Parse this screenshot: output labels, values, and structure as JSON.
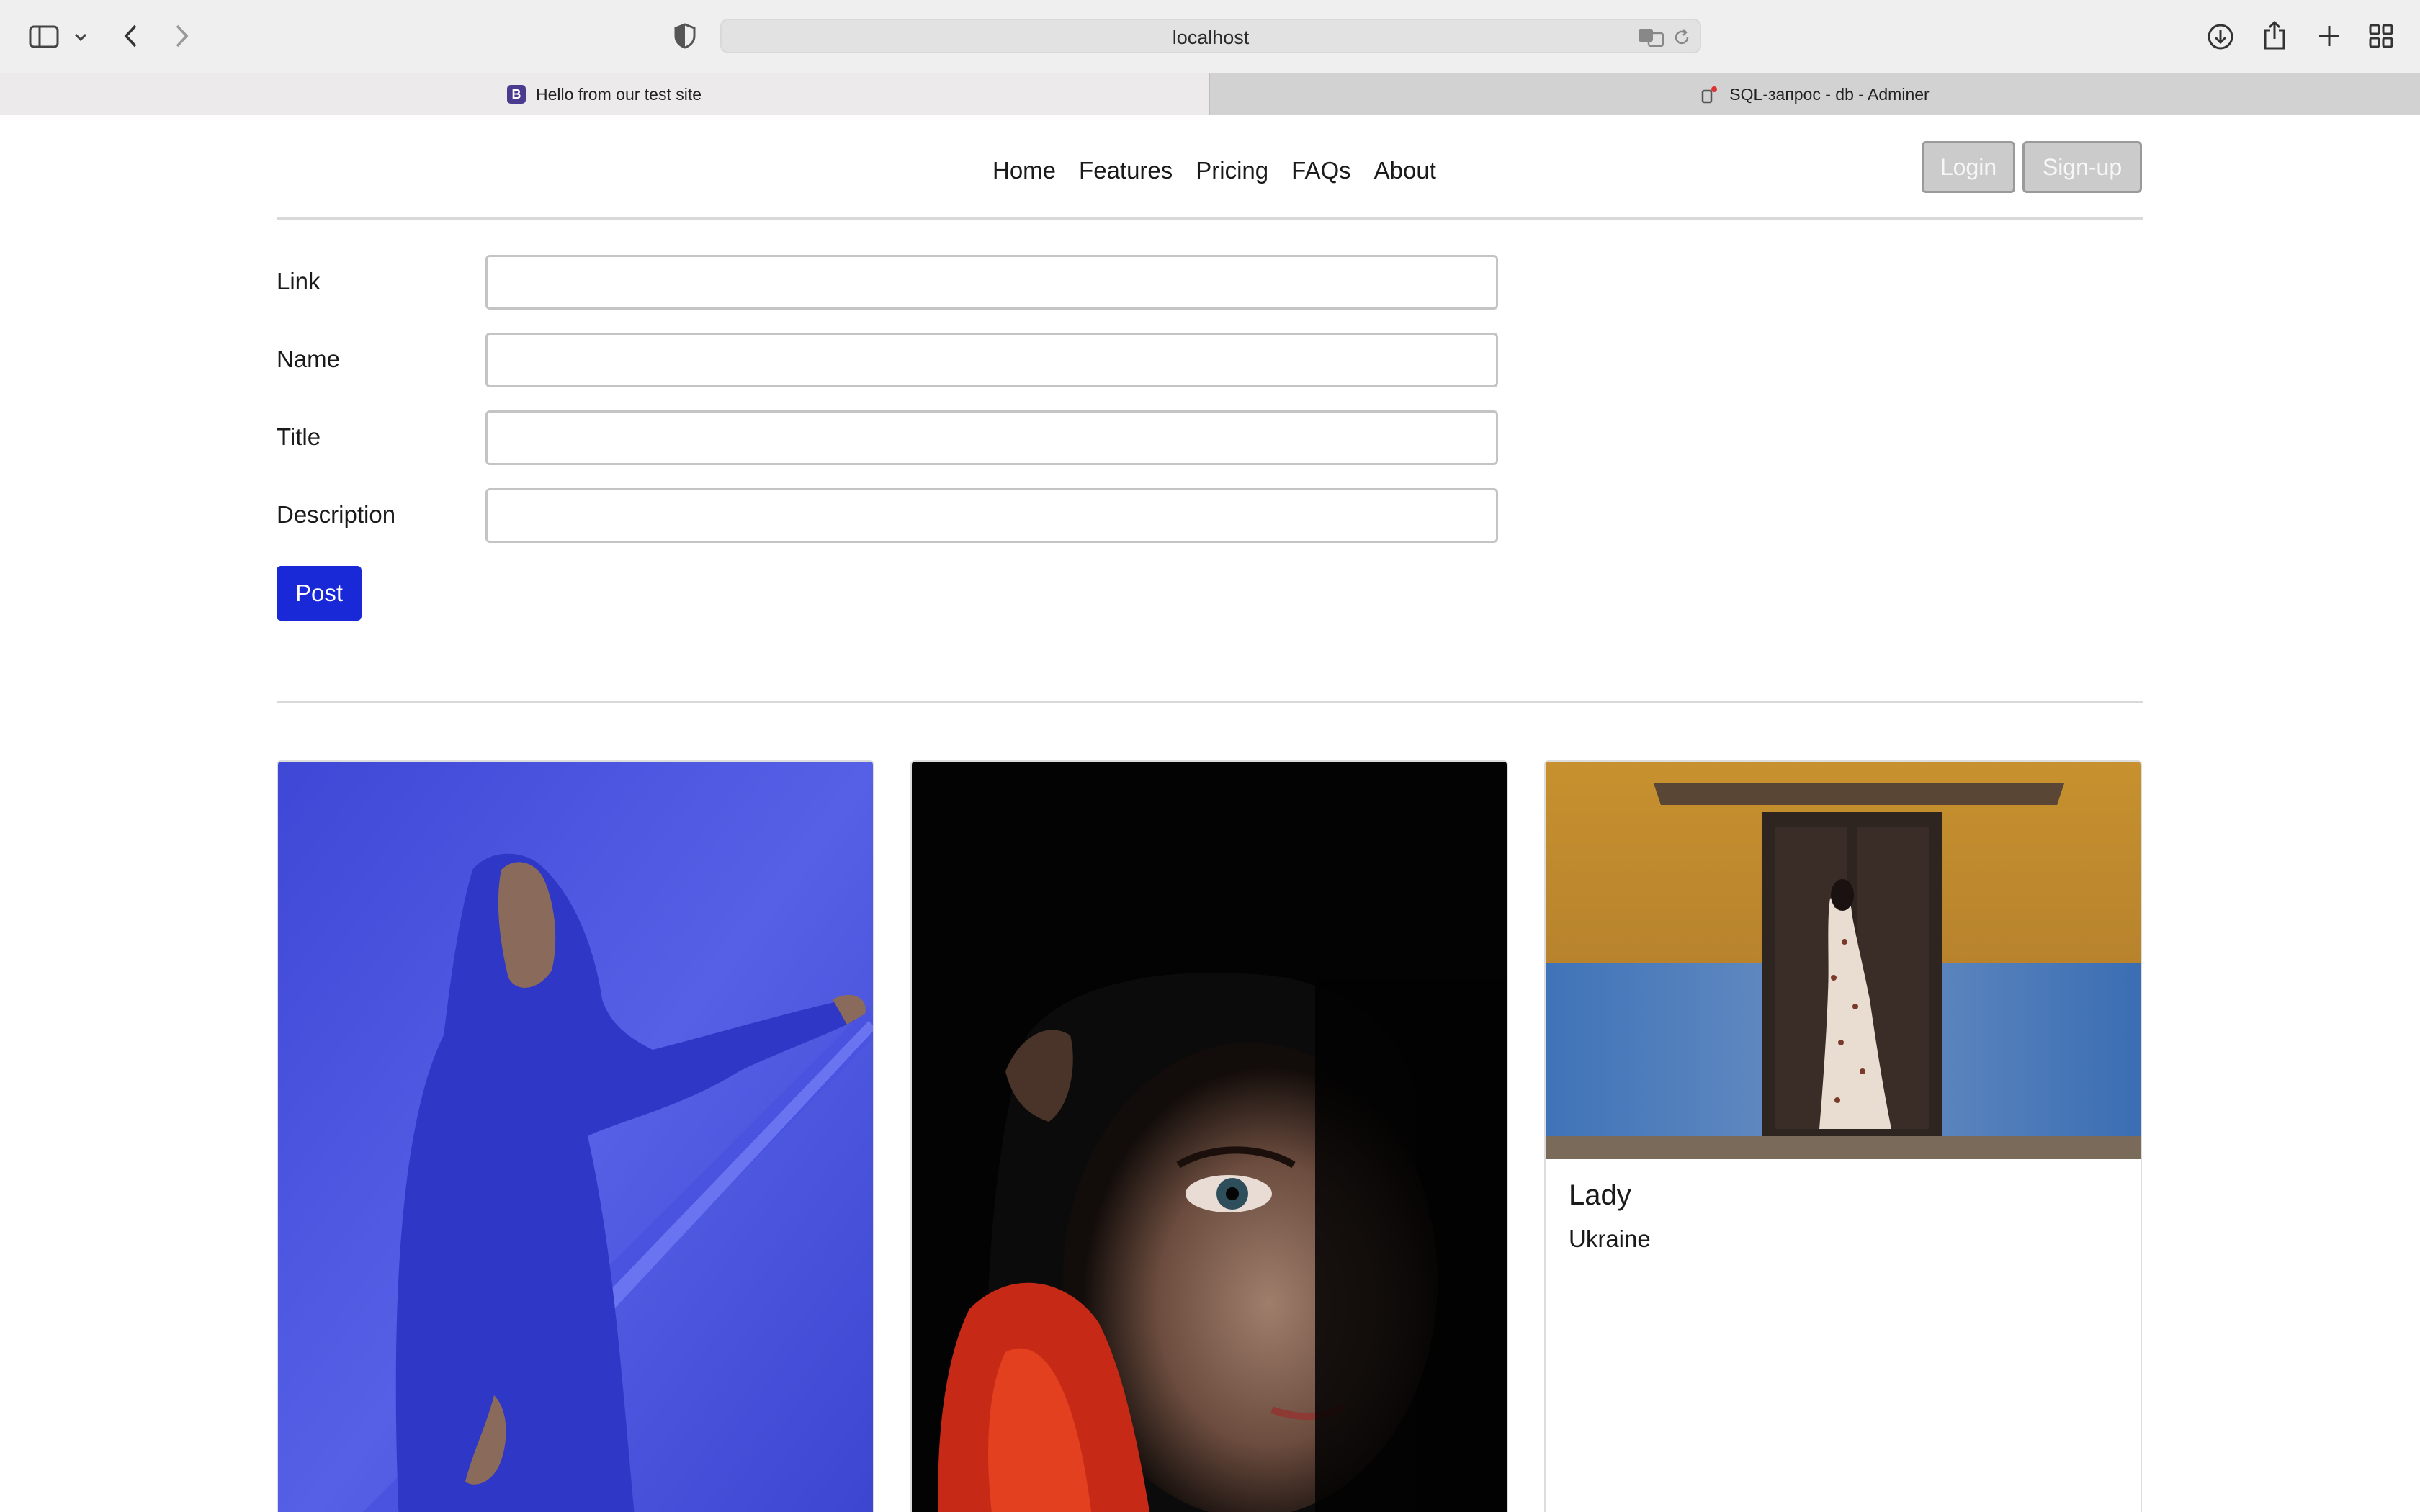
{
  "browser": {
    "url": "localhost",
    "tabs": [
      {
        "title": "Hello from our test site",
        "favicon": "B",
        "active": true
      },
      {
        "title": "SQL-запрос - db - Adminer",
        "active": false
      }
    ]
  },
  "nav": {
    "links": [
      "Home",
      "Features",
      "Pricing",
      "FAQs",
      "About"
    ],
    "login_label": "Login",
    "signup_label": "Sign-up"
  },
  "form": {
    "link_label": "Link",
    "name_label": "Name",
    "title_label": "Title",
    "description_label": "Description",
    "post_label": "Post"
  },
  "cards": [
    {
      "photo": "man in blue hooded robe against blue wall"
    },
    {
      "photo": "woman's face partially lit in darkness"
    },
    {
      "photo": "woman in floral robe walking past doorway",
      "title": "Lady",
      "text": "Ukraine"
    }
  ],
  "colors": {
    "accent": "#1a29d8",
    "disabled_button": "#cbcbcb"
  }
}
